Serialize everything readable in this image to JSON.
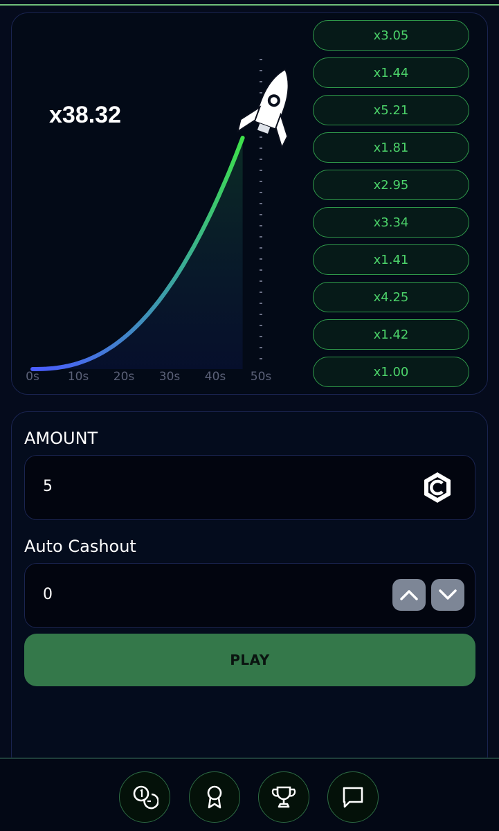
{
  "game": {
    "current_multiplier": "x38.32",
    "axis_ticks": [
      "0s",
      "10s",
      "20s",
      "30s",
      "40s",
      "50s"
    ],
    "history": [
      "x3.05",
      "x1.44",
      "x5.21",
      "x1.81",
      "x2.95",
      "x3.34",
      "x1.41",
      "x4.25",
      "x1.42",
      "x1.00"
    ],
    "elapsed_seconds": 46,
    "colors": {
      "curve_start": "#4a5cff",
      "curve_end": "#3ee04a",
      "history_text": "#4cd36a"
    },
    "icons": {
      "rocket": "rocket-icon"
    }
  },
  "bet": {
    "amount_label": "AMOUNT",
    "amount_value": "5",
    "currency_icon": "coin-c-icon",
    "auto_cashout_label": "Auto Cashout",
    "auto_cashout_value": "0",
    "play_label": "PLAY",
    "colors": {
      "play_button": "#34784a"
    }
  },
  "nav": {
    "items": [
      "bet-history-icon",
      "award-ribbon-icon",
      "trophy-icon",
      "chat-icon"
    ]
  }
}
